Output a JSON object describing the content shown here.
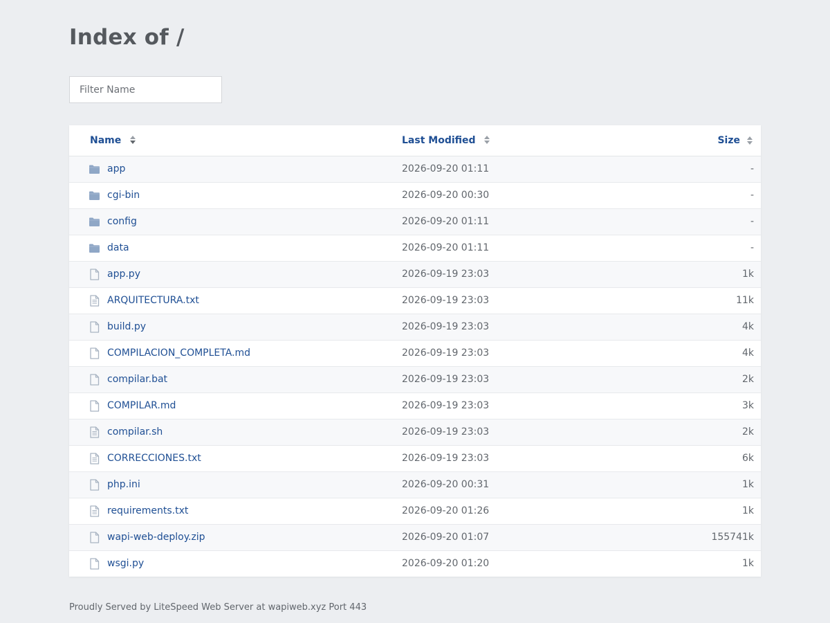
{
  "page": {
    "title": "Index of /",
    "filter_placeholder": "Filter Name",
    "filter_value": "",
    "footer": "Proudly Served by LiteSpeed Web Server at wapiweb.xyz Port 443"
  },
  "columns": {
    "name": "Name",
    "modified": "Last Modified",
    "size": "Size"
  },
  "colors": {
    "link": "#1f4f94",
    "folder_icon": "#8fa7c6",
    "file_icon": "#a9b4c2",
    "background": "#eceef1"
  },
  "rows": [
    {
      "name": "app",
      "modified": "2026-09-20 01:11",
      "size": "-",
      "icon": "folder-icon"
    },
    {
      "name": "cgi-bin",
      "modified": "2026-09-20 00:30",
      "size": "-",
      "icon": "folder-icon"
    },
    {
      "name": "config",
      "modified": "2026-09-20 01:11",
      "size": "-",
      "icon": "folder-icon"
    },
    {
      "name": "data",
      "modified": "2026-09-20 01:11",
      "size": "-",
      "icon": "folder-icon"
    },
    {
      "name": "app.py",
      "modified": "2026-09-19 23:03",
      "size": "1k",
      "icon": "file-icon"
    },
    {
      "name": "ARQUITECTURA.txt",
      "modified": "2026-09-19 23:03",
      "size": "11k",
      "icon": "text-file-icon"
    },
    {
      "name": "build.py",
      "modified": "2026-09-19 23:03",
      "size": "4k",
      "icon": "file-icon"
    },
    {
      "name": "COMPILACION_COMPLETA.md",
      "modified": "2026-09-19 23:03",
      "size": "4k",
      "icon": "file-icon"
    },
    {
      "name": "compilar.bat",
      "modified": "2026-09-19 23:03",
      "size": "2k",
      "icon": "file-icon"
    },
    {
      "name": "COMPILAR.md",
      "modified": "2026-09-19 23:03",
      "size": "3k",
      "icon": "file-icon"
    },
    {
      "name": "compilar.sh",
      "modified": "2026-09-19 23:03",
      "size": "2k",
      "icon": "text-file-icon"
    },
    {
      "name": "CORRECCIONES.txt",
      "modified": "2026-09-19 23:03",
      "size": "6k",
      "icon": "text-file-icon"
    },
    {
      "name": "php.ini",
      "modified": "2026-09-20 00:31",
      "size": "1k",
      "icon": "file-icon"
    },
    {
      "name": "requirements.txt",
      "modified": "2026-09-20 01:26",
      "size": "1k",
      "icon": "text-file-icon"
    },
    {
      "name": "wapi-web-deploy.zip",
      "modified": "2026-09-20 01:07",
      "size": "155741k",
      "icon": "file-icon"
    },
    {
      "name": "wsgi.py",
      "modified": "2026-09-20 01:20",
      "size": "1k",
      "icon": "file-icon"
    }
  ]
}
